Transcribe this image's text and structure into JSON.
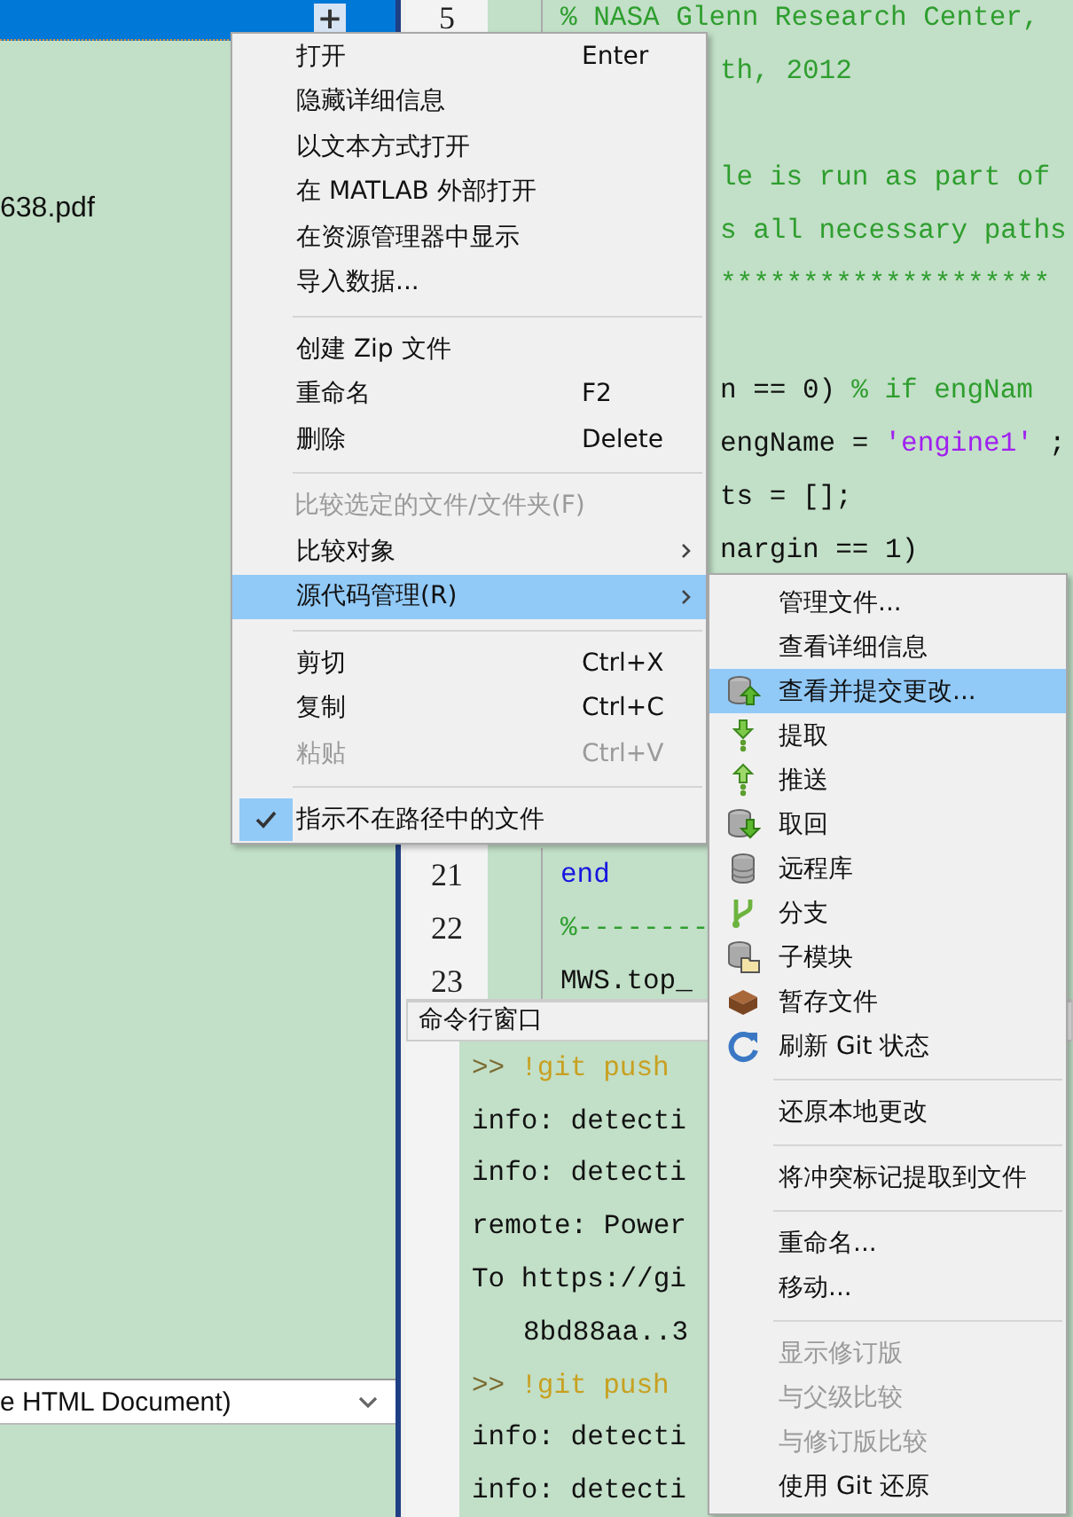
{
  "file_browser": {
    "rows": [
      {
        "selected": true,
        "expander": "+"
      },
      {
        "selected": false,
        "name": "638.pdf"
      }
    ],
    "type_dropdown": {
      "value": "e HTML Document)"
    }
  },
  "editor": {
    "blocks": [
      {
        "lines": [
          {
            "number": "5",
            "parts": [
              {
                "kind": "comment",
                "text": "% NASA Glenn Research Center,"
              }
            ]
          },
          {
            "parts": [
              {
                "kind": "comment",
                "text": "th, 2012"
              }
            ]
          }
        ]
      },
      {
        "lines": [
          {
            "parts": [
              {
                "kind": "comment",
                "text": "le is run as part of"
              }
            ]
          },
          {
            "parts": [
              {
                "kind": "comment",
                "text": "s all necessary paths"
              }
            ]
          },
          {
            "parts": [
              {
                "kind": "comment",
                "text": "********************"
              }
            ]
          }
        ]
      },
      {
        "lines": [
          {
            "parts": [
              {
                "kind": "plain",
                "text": "n == 0)"
              },
              {
                "kind": "comment",
                "text": "% if engNam"
              }
            ]
          },
          {
            "parts": [
              {
                "kind": "plain",
                "text": "engName ="
              },
              {
                "kind": "string",
                "text": "'engine1'"
              },
              {
                "kind": "plain",
                "text": ";"
              }
            ]
          },
          {
            "parts": [
              {
                "kind": "plain",
                "text": "ts = [];"
              }
            ]
          },
          {
            "parts": [
              {
                "kind": "plain",
                "text": "nargin == 1)"
              }
            ]
          }
        ]
      },
      {
        "lines": [
          {
            "number": "21",
            "parts": [
              {
                "kind": "keyword",
                "text": "end"
              }
            ]
          },
          {
            "number": "22",
            "parts": [
              {
                "kind": "comment",
                "text": "%--------"
              }
            ]
          },
          {
            "number": "23",
            "parts": [
              {
                "kind": "plain",
                "text": "MWS.top_"
              }
            ]
          }
        ]
      }
    ]
  },
  "command_window": {
    "title": "命令行窗口",
    "lines": [
      {
        "kind": "command",
        "prompt": ">>",
        "text": "!git push"
      },
      {
        "kind": "output",
        "text": "info: detecti"
      },
      {
        "kind": "output",
        "text": "info: detecti"
      },
      {
        "kind": "output",
        "text": "remote: Power"
      },
      {
        "kind": "output",
        "text": "To https://gi"
      },
      {
        "kind": "continuation",
        "text": "8bd88aa..3"
      },
      {
        "kind": "command",
        "prompt": ">>",
        "text": "!git push"
      },
      {
        "kind": "output",
        "text": "info: detecti"
      },
      {
        "kind": "output",
        "text": "info: detecti"
      }
    ]
  },
  "context_menu": {
    "items": [
      {
        "kind": "item",
        "label": "打开",
        "shortcut": "Enter",
        "disabled": false,
        "selected": false,
        "checked": false,
        "submenu": false
      },
      {
        "kind": "item",
        "label": "隐藏详细信息",
        "disabled": false,
        "selected": false,
        "checked": false,
        "submenu": false
      },
      {
        "kind": "item",
        "label": "以文本方式打开",
        "disabled": false,
        "selected": false,
        "checked": false,
        "submenu": false
      },
      {
        "kind": "item",
        "label": "在 MATLAB 外部打开",
        "disabled": false,
        "selected": false,
        "checked": false,
        "submenu": false
      },
      {
        "kind": "item",
        "label": "在资源管理器中显示",
        "disabled": false,
        "selected": false,
        "checked": false,
        "submenu": false
      },
      {
        "kind": "item",
        "label": "导入数据...",
        "disabled": false,
        "selected": false,
        "checked": false,
        "submenu": false
      },
      {
        "kind": "separator"
      },
      {
        "kind": "item",
        "label": "创建 Zip 文件",
        "disabled": false,
        "selected": false,
        "checked": false,
        "submenu": false
      },
      {
        "kind": "item",
        "label": "重命名",
        "shortcut": "F2",
        "disabled": false,
        "selected": false,
        "checked": false,
        "submenu": false
      },
      {
        "kind": "item",
        "label": "删除",
        "shortcut": "Delete",
        "disabled": false,
        "selected": false,
        "checked": false,
        "submenu": false
      },
      {
        "kind": "separator"
      },
      {
        "kind": "item",
        "label": "比较选定的文件/文件夹(F)",
        "disabled": true,
        "selected": false,
        "checked": false,
        "submenu": false
      },
      {
        "kind": "item",
        "label": "比较对象",
        "disabled": false,
        "selected": false,
        "checked": false,
        "submenu": true
      },
      {
        "kind": "item",
        "label": "源代码管理(R)",
        "disabled": false,
        "selected": true,
        "checked": false,
        "submenu": true
      },
      {
        "kind": "separator"
      },
      {
        "kind": "item",
        "label": "剪切",
        "shortcut": "Ctrl+X",
        "disabled": false,
        "selected": false,
        "checked": false,
        "submenu": false
      },
      {
        "kind": "item",
        "label": "复制",
        "shortcut": "Ctrl+C",
        "disabled": false,
        "selected": false,
        "checked": false,
        "submenu": false
      },
      {
        "kind": "item",
        "label": "粘贴",
        "shortcut": "Ctrl+V",
        "disabled": true,
        "selected": false,
        "checked": false,
        "submenu": false
      },
      {
        "kind": "separator"
      },
      {
        "kind": "item",
        "label": "指示不在路径中的文件",
        "disabled": false,
        "selected": false,
        "checked": true,
        "submenu": false
      }
    ]
  },
  "submenu": {
    "items": [
      {
        "kind": "item",
        "label": "管理文件...",
        "disabled": false,
        "selected": false
      },
      {
        "kind": "item",
        "label": "查看详细信息",
        "disabled": false,
        "selected": false
      },
      {
        "kind": "item",
        "label": "查看并提交更改...",
        "disabled": false,
        "selected": true
      },
      {
        "kind": "item",
        "label": "提取",
        "disabled": false,
        "selected": false
      },
      {
        "kind": "item",
        "label": "推送",
        "disabled": false,
        "selected": false
      },
      {
        "kind": "item",
        "label": "取回",
        "disabled": false,
        "selected": false
      },
      {
        "kind": "item",
        "label": "远程库",
        "disabled": false,
        "selected": false
      },
      {
        "kind": "item",
        "label": "分支",
        "disabled": false,
        "selected": false
      },
      {
        "kind": "item",
        "label": "子模块",
        "disabled": false,
        "selected": false
      },
      {
        "kind": "item",
        "label": "暂存文件",
        "disabled": false,
        "selected": false
      },
      {
        "kind": "item",
        "label": "刷新 Git 状态",
        "disabled": false,
        "selected": false
      },
      {
        "kind": "separator"
      },
      {
        "kind": "item",
        "label": "还原本地更改",
        "disabled": false,
        "selected": false
      },
      {
        "kind": "separator"
      },
      {
        "kind": "item",
        "label": "将冲突标记提取到文件",
        "disabled": false,
        "selected": false
      },
      {
        "kind": "separator"
      },
      {
        "kind": "item",
        "label": "重命名...",
        "disabled": false,
        "selected": false
      },
      {
        "kind": "item",
        "label": "移动...",
        "disabled": false,
        "selected": false
      },
      {
        "kind": "separator"
      },
      {
        "kind": "item",
        "label": "显示修订版",
        "disabled": true,
        "selected": false
      },
      {
        "kind": "item",
        "label": "与父级比较",
        "disabled": true,
        "selected": false
      },
      {
        "kind": "item",
        "label": "与修订版比较",
        "disabled": true,
        "selected": false
      },
      {
        "kind": "item",
        "label": "使用 Git 还原",
        "disabled": false,
        "selected": false
      }
    ]
  }
}
